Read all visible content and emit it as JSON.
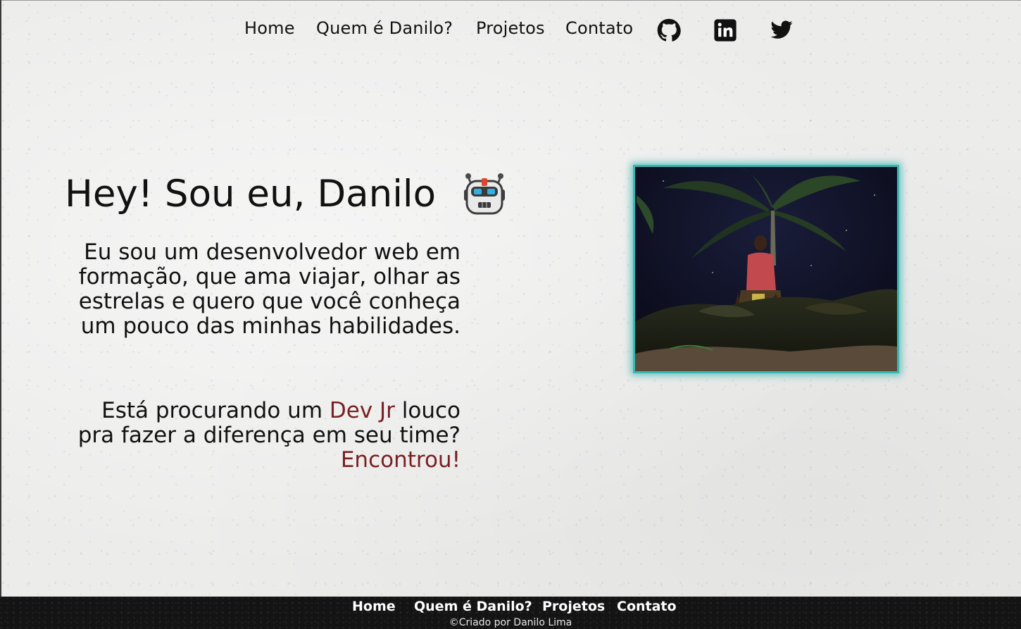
{
  "nav": {
    "home": "Home",
    "about": "Quem é Danilo?",
    "projects": "Projetos",
    "contact": "Contato",
    "social": [
      "github-icon",
      "linkedin-icon",
      "twitter-icon"
    ]
  },
  "hero": {
    "title": "Hey! Sou eu, Danilo",
    "emoji_icon": "robot-icon",
    "intro": "Eu sou um desenvolvedor web em formação, que ama viajar, olhar as estrelas e quero que você conheça um pouco das minhas habilidades.",
    "cta_part1": "Está procurando um ",
    "cta_highlight1": "Dev Jr",
    "cta_part2": " louco pra fazer a diferença em seu time? ",
    "cta_highlight2": "Encontrou!",
    "highlight_color": "#7a1f22"
  },
  "photo": {
    "border_color": "#39b7b2"
  },
  "footer": {
    "home": "Home",
    "about": "Quem é Danilo?",
    "projects": "Projetos",
    "contact": "Contato",
    "copyright": "©Criado por Danilo Lima"
  }
}
